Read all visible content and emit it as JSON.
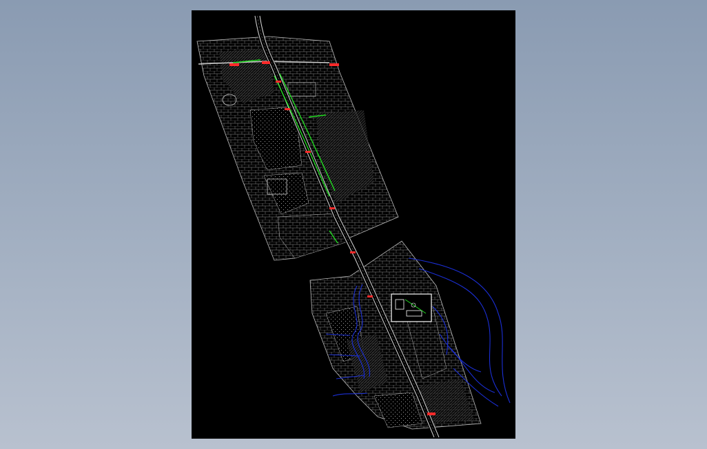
{
  "viewer": {
    "background_top": "#8a9bb2",
    "background_bottom": "#b8c1cf",
    "sheet_color": "#000000"
  },
  "drawing": {
    "colors": {
      "base_linework": "#bdbdbd",
      "road_centerline": "#d8d8d8",
      "planting_green": "#22dd22",
      "water_blue": "#1b2fd6",
      "station_marker_red": "#ff2a2a",
      "inset_frame": "#ffffff"
    },
    "labels": {
      "station_north_west": "",
      "station_north_east": ""
    }
  }
}
